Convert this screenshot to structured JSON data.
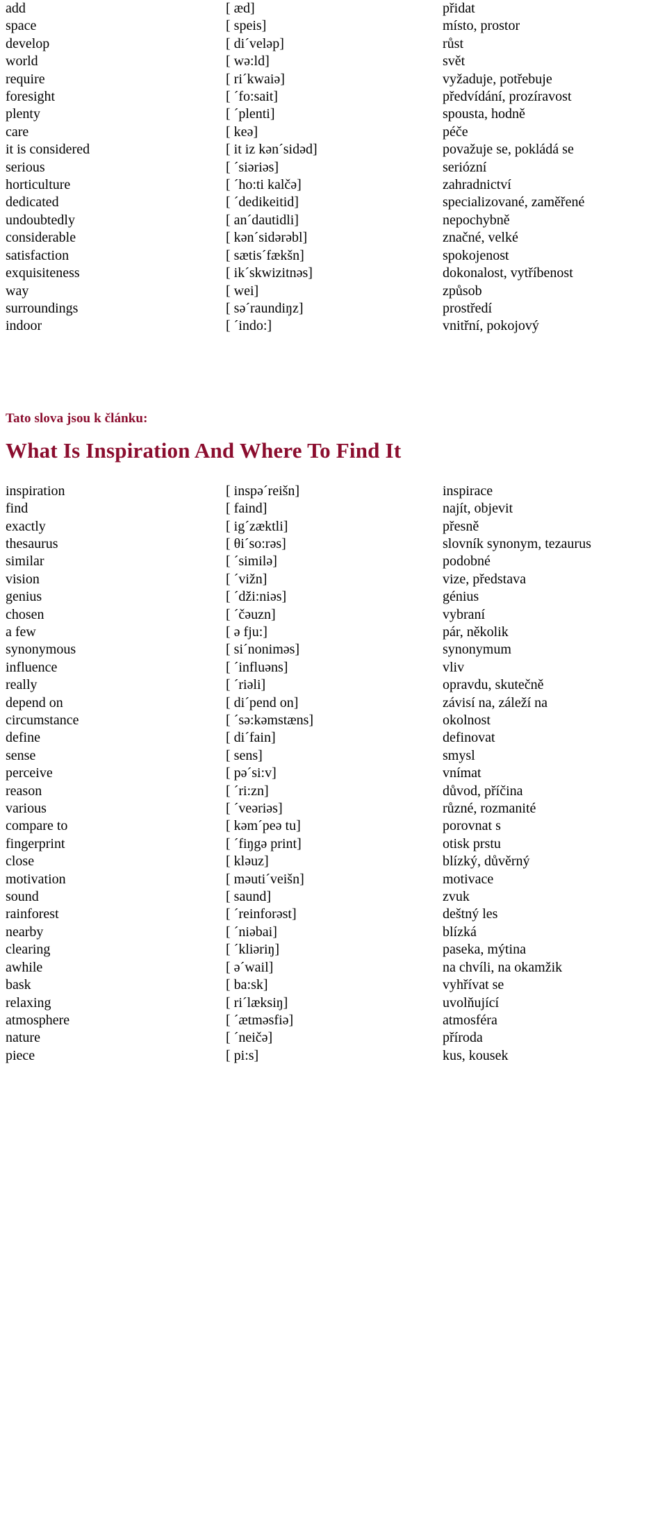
{
  "document": {
    "accent_color": "#8B0D2E",
    "text_color": "#000000",
    "background_color": "#ffffff"
  },
  "section_one": {
    "rows": [
      {
        "term": "add",
        "phonetic": "[ æd]",
        "translation": "přidat"
      },
      {
        "term": "space",
        "phonetic": "[ speis]",
        "translation": "místo, prostor"
      },
      {
        "term": "develop",
        "phonetic": "[ di´veləp]",
        "translation": "růst"
      },
      {
        "term": "world",
        "phonetic": "[ wə:ld]",
        "translation": "svět"
      },
      {
        "term": "require",
        "phonetic": "[ ri´kwaiə]",
        "translation": "vyžaduje, potřebuje"
      },
      {
        "term": "foresight",
        "phonetic": "[ ´fo:sait]",
        "translation": "předvídání, prozíravost"
      },
      {
        "term": "plenty",
        "phonetic": "[ ´plenti]",
        "translation": "spousta, hodně"
      },
      {
        "term": "care",
        "phonetic": "[ keə]",
        "translation": "péče"
      },
      {
        "term": "it is considered",
        "phonetic": "[ it iz kən´sidəd]",
        "translation": "považuje se, pokládá se"
      },
      {
        "term": "serious",
        "phonetic": "[ ´siəriəs]",
        "translation": "seriózní"
      },
      {
        "term": "horticulture",
        "phonetic": "[ ´ho:ti kalčə]",
        "translation": "zahradnictví"
      },
      {
        "term": "dedicated",
        "phonetic": "[ ´dedikeitid]",
        "translation": "specializované, zaměřené"
      },
      {
        "term": "undoubtedly",
        "phonetic": "[ an´dautidli]",
        "translation": "nepochybně"
      },
      {
        "term": "considerable",
        "phonetic": "[ kən´sidərəbl]",
        "translation": "značné, velké"
      },
      {
        "term": "satisfaction",
        "phonetic": "[ sætis´fækšn]",
        "translation": "spokojenost"
      },
      {
        "term": "exquisiteness",
        "phonetic": "[ ik´skwizitnəs]",
        "translation": "dokonalost, vytříbenost"
      },
      {
        "term": "way",
        "phonetic": "[ wei]",
        "translation": "způsob"
      },
      {
        "term": "surroundings",
        "phonetic": "[ sə´raundiŋz]",
        "translation": "prostředí"
      },
      {
        "term": "indoor",
        "phonetic": "[ ´indo:]",
        "translation": "vnitřní, pokojový"
      }
    ]
  },
  "article_header": {
    "intro_label": "Tato slova jsou k článku:",
    "title": "What Is Inspiration And Where To Find It"
  },
  "section_two": {
    "rows": [
      {
        "term": "inspiration",
        "phonetic": "[ inspə´reišn]",
        "translation": "inspirace"
      },
      {
        "term": "find",
        "phonetic": "[ faind]",
        "translation": "najít, objevit"
      },
      {
        "term": "exactly",
        "phonetic": "[ ig´zæktli]",
        "translation": "přesně"
      },
      {
        "term": "thesaurus",
        "phonetic": "[ θi´so:rəs]",
        "translation": "slovník synonym, tezaurus"
      },
      {
        "term": "similar",
        "phonetic": "[ ´similə]",
        "translation": "podobné"
      },
      {
        "term": "vision",
        "phonetic": "[ ´vižn]",
        "translation": "vize, představa"
      },
      {
        "term": "genius",
        "phonetic": "[ ´dži:niəs]",
        "translation": "génius"
      },
      {
        "term": "chosen",
        "phonetic": "[ ´čəuzn]",
        "translation": "vybraní"
      },
      {
        "term": "a few",
        "phonetic": "[ ə fju:]",
        "translation": "pár, několik"
      },
      {
        "term": "synonymous",
        "phonetic": "[ si´noniməs]",
        "translation": "synonymum"
      },
      {
        "term": "influence",
        "phonetic": "[ ´influəns]",
        "translation": "vliv"
      },
      {
        "term": "really",
        "phonetic": "[ ´riəli]",
        "translation": "opravdu, skutečně"
      },
      {
        "term": "depend on",
        "phonetic": "[ di´pend on]",
        "translation": "závisí na, záleží na"
      },
      {
        "term": "circumstance",
        "phonetic": "[ ´sə:kəmstæns]",
        "translation": "okolnost"
      },
      {
        "term": "define",
        "phonetic": "[ di´fain]",
        "translation": "definovat"
      },
      {
        "term": "sense",
        "phonetic": "[ sens]",
        "translation": "smysl"
      },
      {
        "term": "perceive",
        "phonetic": "[ pə´si:v]",
        "translation": "vnímat"
      },
      {
        "term": "reason",
        "phonetic": "[ ´ri:zn]",
        "translation": "důvod, příčina"
      },
      {
        "term": "various",
        "phonetic": "[ ´veəriəs]",
        "translation": "různé, rozmanité"
      },
      {
        "term": "compare to",
        "phonetic": "[ kəm´peə tu]",
        "translation": "porovnat s"
      },
      {
        "term": "fingerprint",
        "phonetic": "[ ´fiŋgə print]",
        "translation": "otisk prstu"
      },
      {
        "term": "close",
        "phonetic": "[ kləuz]",
        "translation": "blízký, důvěrný"
      },
      {
        "term": "motivation",
        "phonetic": "[ məuti´veišn]",
        "translation": "motivace"
      },
      {
        "term": "sound",
        "phonetic": "[ saund]",
        "translation": "zvuk"
      },
      {
        "term": "rainforest",
        "phonetic": "[ ´reinforəst]",
        "translation": "deštný les"
      },
      {
        "term": "nearby",
        "phonetic": "[ ´niəbai]",
        "translation": "blízká"
      },
      {
        "term": "clearing",
        "phonetic": "[ ´kliəriŋ]",
        "translation": "paseka, mýtina"
      },
      {
        "term": "awhile",
        "phonetic": "[ ə´wail]",
        "translation": "na chvíli, na okamžik"
      },
      {
        "term": "bask",
        "phonetic": "[ ba:sk]",
        "translation": "vyhřívat se"
      },
      {
        "term": "relaxing",
        "phonetic": "[ ri´læksiŋ]",
        "translation": "uvolňující"
      },
      {
        "term": "atmosphere",
        "phonetic": "[ ´ætməsfiə]",
        "translation": "atmosféra"
      },
      {
        "term": "nature",
        "phonetic": "[ ´neičə]",
        "translation": "příroda"
      },
      {
        "term": "piece",
        "phonetic": "[ pi:s]",
        "translation": "kus, kousek"
      }
    ]
  }
}
